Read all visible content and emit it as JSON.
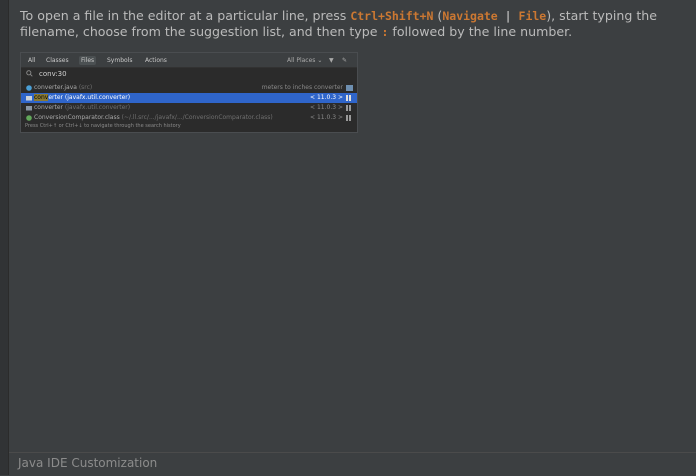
{
  "tip": {
    "part1": "To open a file in the editor at a particular line, press ",
    "shortcut": "Ctrl+Shift+N",
    "part2": " (",
    "menu_a": "Navigate",
    "menu_sep": " | ",
    "menu_b": "File",
    "part3": "), start typing the filename, choose from the suggestion list, and then type ",
    "colon": ":",
    "part4": " followed by the line number."
  },
  "popup": {
    "tabs": [
      "All",
      "Classes",
      "Files",
      "Symbols",
      "Actions"
    ],
    "active_tab": "Files",
    "scope": "All Places",
    "search_query": "conv:30",
    "results": [
      {
        "name": "converter.java",
        "detail": " (src)",
        "location": "meters to inches converter",
        "selected": false,
        "icon": "java-file-icon"
      },
      {
        "name_hl": "conv",
        "name_rest": "erter",
        "detail": " (javafx.util.converter)",
        "location": "< 11.0.3 >",
        "selected": true,
        "icon": "package-folder-icon"
      },
      {
        "name": "converter",
        "detail": " (javafx.util.converter)",
        "location": "< 11.0.3 >",
        "selected": false,
        "icon": "package-folder-icon"
      },
      {
        "name": "ConversionComparator.class",
        "detail": " (~/.ll.src/.../javafx/.../ConversionComparator.class)",
        "location": "< 11.0.3 >",
        "selected": false,
        "icon": "class-file-icon"
      }
    ],
    "hint": "Press Ctrl+↑ or Ctrl+↓ to navigate through the search history"
  },
  "footer": {
    "title": "Java IDE Customization"
  },
  "colors": {
    "background": "#3c3f41",
    "keyword": "#cc7832",
    "selection": "#2f65ca"
  }
}
